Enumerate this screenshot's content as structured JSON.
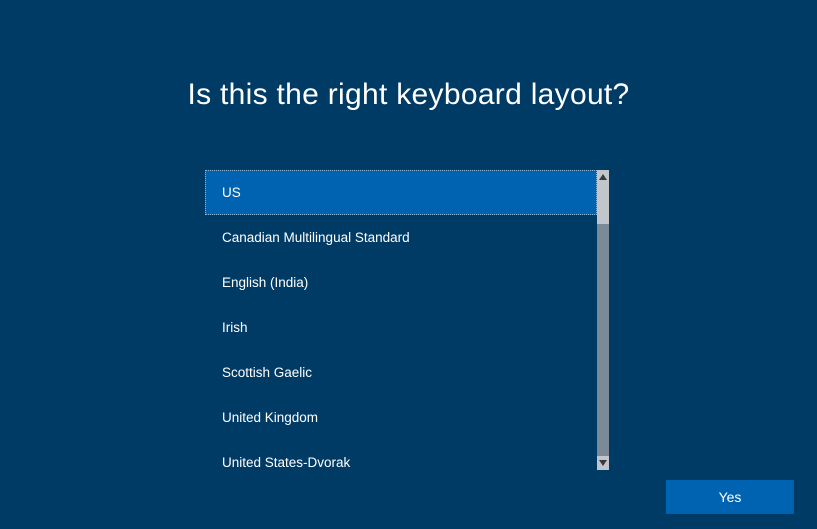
{
  "heading": "Is this the right keyboard layout?",
  "layouts": {
    "items": [
      "US",
      "Canadian Multilingual Standard",
      "English (India)",
      "Irish",
      "Scottish Gaelic",
      "United Kingdom",
      "United States-Dvorak"
    ],
    "selected_index": 0
  },
  "buttons": {
    "yes": "Yes"
  },
  "colors": {
    "background": "#003b66",
    "accent": "#0063b1"
  }
}
